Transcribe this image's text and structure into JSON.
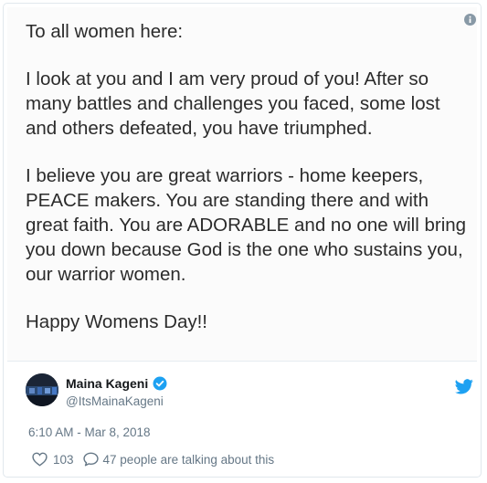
{
  "post": {
    "paragraphs": [
      "To all women here:",
      "I look at you and I am very proud of you! After so many battles and challenges you faced, some lost and others defeated, you have triumphed.",
      "I believe you are great warriors -  home keepers, PEACE makers. You are standing there and with great faith. You are ADORABLE and no one will bring you down because God is the one who sustains you, our warrior women.",
      "Happy Womens Day!!"
    ]
  },
  "author": {
    "name": "Maina Kageni",
    "handle": "@ItsMainaKageni"
  },
  "timestamp": "6:10 AM - Mar 8, 2018",
  "stats": {
    "likes": "103",
    "talking": "47 people are talking about this"
  },
  "colors": {
    "twitter_blue": "#1da1f2",
    "muted_text": "#657786",
    "name_text": "#14171a"
  },
  "icons": [
    "info-icon",
    "verified-badge-icon",
    "twitter-bird-icon",
    "heart-icon",
    "reply-bubble-icon"
  ]
}
